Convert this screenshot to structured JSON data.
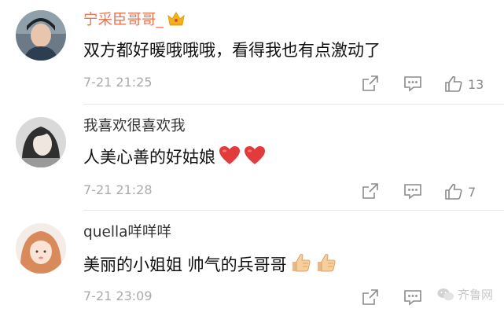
{
  "comments": [
    {
      "username": "宁采臣哥哥_",
      "vip": true,
      "badge_icon": "crown-icon",
      "text": "双方都好暖哦哦哦，看得我也有点激动了",
      "time": "7-21 21:25",
      "likes": "13"
    },
    {
      "username": "我喜欢很喜欢我",
      "vip": false,
      "text": "人美心善的好姑娘",
      "emoji": [
        "red-heart-icon",
        "red-heart-icon"
      ],
      "time": "7-21 21:28",
      "likes": "7"
    },
    {
      "username": "quella咩咩咩",
      "vip": false,
      "text": "美丽的小姐姐 帅气的兵哥哥",
      "emoji": [
        "thumbs-up-icon",
        "thumbs-up-icon"
      ],
      "time": "7-21 23:09",
      "likes": ""
    }
  ],
  "watermark": "齐鲁网",
  "colors": {
    "vip_name": "#eb7350",
    "meta": "#aaaaaa"
  }
}
